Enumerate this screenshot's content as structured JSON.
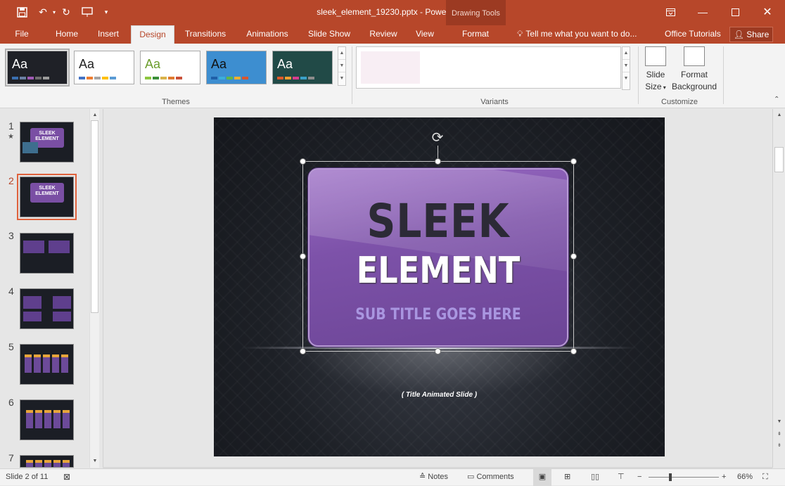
{
  "title_bar": {
    "document_title": "sleek_element_19230.pptx - PowerPoint",
    "contextual_group": "Drawing Tools",
    "qat_icons": [
      "save-icon",
      "undo-icon",
      "redo-icon",
      "start-from-beginning-icon",
      "customize-qat-icon"
    ],
    "window_icons": [
      "ribbon-display-options-icon",
      "minimize-icon",
      "maximize-icon",
      "close-icon"
    ],
    "accent_color": "#b7472a"
  },
  "tabs": [
    {
      "label": "File"
    },
    {
      "label": "Home"
    },
    {
      "label": "Insert"
    },
    {
      "label": "Design"
    },
    {
      "label": "Transitions"
    },
    {
      "label": "Animations"
    },
    {
      "label": "Slide Show"
    },
    {
      "label": "Review"
    },
    {
      "label": "View"
    },
    {
      "label": "Format"
    }
  ],
  "active_tab": "Design",
  "tell_me": "Tell me what you want to do...",
  "office_tutorials": "Office Tutorials",
  "share": "Share",
  "ribbon": {
    "themes": [
      {
        "label": "Aa",
        "bg": "#1f2127",
        "fg": "#ffffff",
        "bars": [
          "#3a6fb0",
          "#6a7fa3",
          "#a05ab5",
          "#6f6f6f",
          "#9b9b9b"
        ]
      },
      {
        "label": "Aa",
        "bg": "#ffffff",
        "fg": "#222222",
        "bars": [
          "#4472c4",
          "#ed7d31",
          "#a5a5a5",
          "#ffc000",
          "#5b9bd5"
        ]
      },
      {
        "label": "Aa",
        "bg": "#ffffff",
        "fg": "#6b9d2c",
        "bars": [
          "#8cc63f",
          "#3a8f3a",
          "#d9b34a",
          "#e07b2f",
          "#c9513a"
        ]
      },
      {
        "label": "Aa",
        "bg": "#3d8ed0",
        "fg": "#111111",
        "bars": [
          "#1f5fa8",
          "#3aaedc",
          "#63b646",
          "#f0b030",
          "#d8562e"
        ]
      },
      {
        "label": "Aa",
        "bg": "#214a47",
        "fg": "#ffffff",
        "bars": [
          "#e05a2a",
          "#f0a030",
          "#d63c8e",
          "#3aa0c8",
          "#8c8c8c"
        ]
      }
    ],
    "themes_label": "Themes",
    "variants_label": "Variants",
    "slide_size_label": "Slide",
    "slide_size_label2": "Size",
    "format_bg_label": "Format",
    "format_bg_label2": "Background",
    "customize_label": "Customize"
  },
  "slides": [
    {
      "num": "1",
      "star": "★",
      "title": "SLEEK ELEMENT"
    },
    {
      "num": "2",
      "title": "SLEEK ELEMENT"
    },
    {
      "num": "3"
    },
    {
      "num": "4"
    },
    {
      "num": "5"
    },
    {
      "num": "6"
    },
    {
      "num": "7"
    }
  ],
  "current_slide": "2",
  "slide": {
    "title_line1": "SLEEK",
    "title_line2": "ELEMENT",
    "subtitle": "SUB TITLE GOES HERE",
    "note": "( Title Animated Slide )"
  },
  "status": {
    "slide_info": "Slide 2 of 11",
    "notes": "Notes",
    "comments": "Comments",
    "zoom": "66%",
    "zoom_level_percent": 66,
    "zoom_minus": "−",
    "zoom_plus": "+"
  }
}
